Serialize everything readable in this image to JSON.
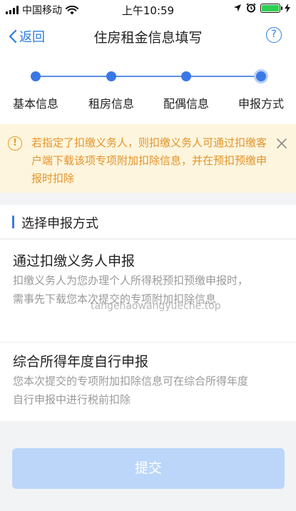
{
  "status_bar": {
    "carrier": "中国移动",
    "time": "上午10:59",
    "battery_color": "#2fcf52"
  },
  "nav": {
    "back_label": "返回",
    "title": "住房租金信息填写",
    "help_symbol": "?"
  },
  "stepper": {
    "steps": [
      "基本信息",
      "租房信息",
      "配偶信息",
      "申报方式"
    ],
    "active_index": 3
  },
  "notice": {
    "icon": "!",
    "text": "若指定了扣缴义务人，则扣缴义务人可通过扣缴客户端下载该项专项附加扣除信息，并在预扣预缴申报时扣除"
  },
  "section": {
    "title": "选择申报方式"
  },
  "options": [
    {
      "title": "通过扣缴义务人申报",
      "description": "扣缴义务人为您办理个人所得税预扣预缴申报时，需事先下载您本次提交的专项附加扣除信息"
    },
    {
      "title": "综合所得年度自行申报",
      "description": "您本次提交的专项附加扣除信息可在综合所得年度自行申报中进行税前扣除"
    }
  ],
  "watermark": "tangehaowangyueche.top",
  "submit_label": "提交",
  "colors": {
    "accent": "#3b78e7",
    "link": "#2a7de1",
    "notice_bg": "#fdf5dd",
    "notice_text": "#e3942c",
    "submit_disabled": "#bcd6f9"
  }
}
